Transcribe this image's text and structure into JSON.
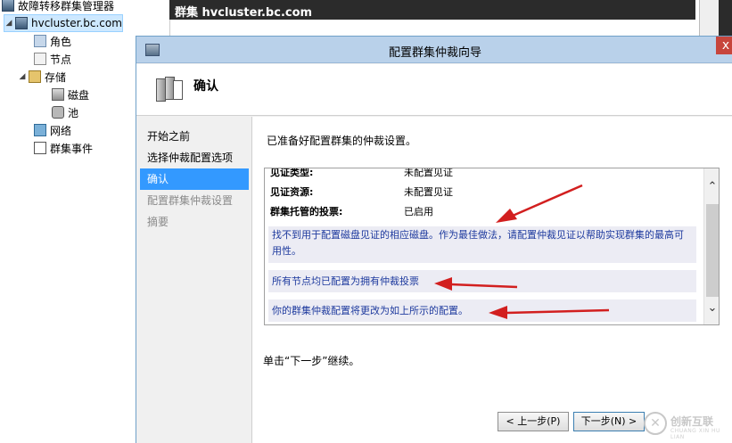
{
  "tree": {
    "root_label": "故障转移群集管理器",
    "cluster": "hvcluster.bc.com",
    "roles": "角色",
    "nodes": "节点",
    "storage": "存储",
    "disks": "磁盘",
    "pools": "池",
    "networks": "网络",
    "events": "群集事件"
  },
  "background_panel": {
    "title": "群集 hvcluster.bc.com"
  },
  "dialog": {
    "title": "配置群集仲裁向导",
    "close_glyph": "x",
    "header": "确认",
    "steps": [
      {
        "label": "开始之前",
        "state": "done"
      },
      {
        "label": "选择仲裁配置选项",
        "state": "done"
      },
      {
        "label": "确认",
        "state": "active"
      },
      {
        "label": "配置群集仲裁设置",
        "state": "pending"
      },
      {
        "label": "摘要",
        "state": "pending"
      }
    ],
    "ready_text": "已准备好配置群集的仲裁设置。",
    "details": [
      {
        "key": "见证类型:",
        "value": "未配置见证"
      },
      {
        "key": "见证资源:",
        "value": "未配置见证"
      },
      {
        "key": "群集托管的投票:",
        "value": "已启用"
      }
    ],
    "messages": [
      "找不到用于配置磁盘见证的相应磁盘。作为最佳做法，请配置仲裁见证以帮助实现群集的最高可用性。",
      "所有节点均已配置为拥有仲裁投票",
      "你的群集仲裁配置将更改为如上所示的配置。"
    ],
    "hint": "单击“下一步”继续。",
    "prev_button": "< 上一步(P)",
    "next_button": "下一步(N) >"
  },
  "watermark": {
    "brand": "创新互联",
    "sub": "CHUANG XIN HU LIAN"
  },
  "colors": {
    "titlebar": "#b9d1ea",
    "step_active": "#3399ff",
    "message_text": "#1e3a9e",
    "arrow": "#d21f1f"
  }
}
